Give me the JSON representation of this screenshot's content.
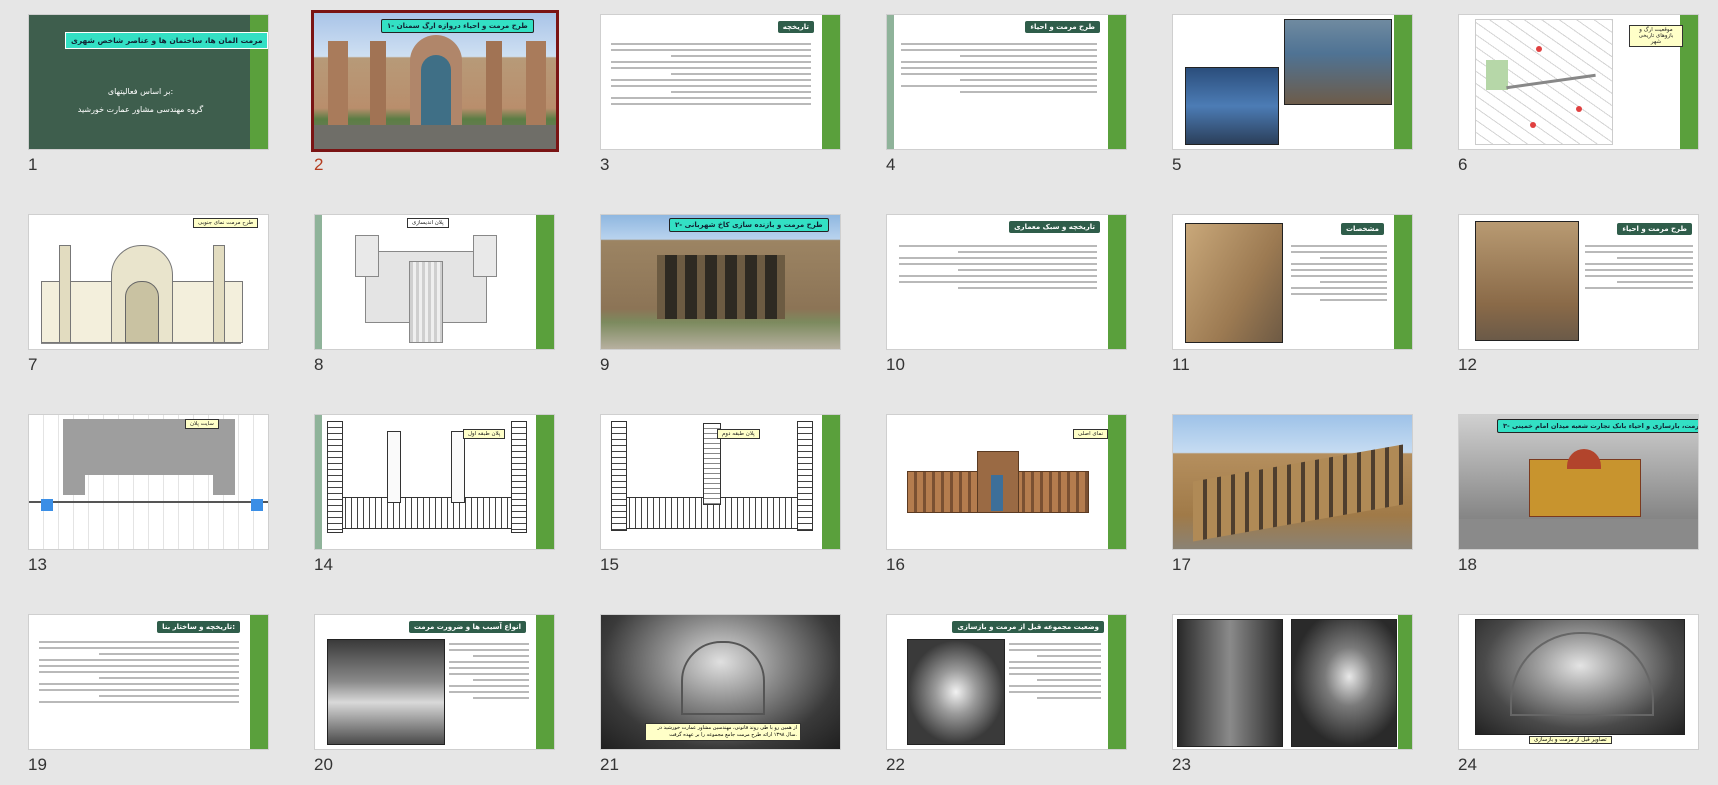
{
  "slide_numbers": [
    "1",
    "2",
    "3",
    "4",
    "5",
    "6",
    "7",
    "8",
    "9",
    "10",
    "11",
    "12",
    "13",
    "14",
    "15",
    "16",
    "17",
    "18",
    "19",
    "20",
    "21",
    "22",
    "23",
    "24"
  ],
  "selected_slide": "2",
  "s1": {
    "title": "مرمت المان ها، ساختمان ها و عناصر شاخص شهری",
    "line1": "بر اساس فعالیتهای:",
    "line2": "گروه مهندسی مشاور عمارت خورشید"
  },
  "s2": {
    "title": "۱- طرح مرمت و احیاء دروازه ارگ سمنان"
  },
  "s3": {
    "title": "تاریخچه"
  },
  "s4": {
    "title": "طرح مرمت و احیاء"
  },
  "s6": {
    "label": "موقعیت ارگ و بازوهای تاریخی شهر"
  },
  "s7": {
    "label": "طرح مرمت نمای جنوبی"
  },
  "s8": {
    "label": "پلان اندیسازی"
  },
  "s9": {
    "title": "۲- طرح مرمت و بازنده سازی کاخ شهربانی"
  },
  "s10": {
    "title": "تاریخچه و سبک معماری"
  },
  "s11": {
    "title": "مشخصات"
  },
  "s12": {
    "title": "طرح مرمت و احیاء"
  },
  "s13": {
    "label": "سایت پلان"
  },
  "s14": {
    "label": "پلان طبقه اول"
  },
  "s15": {
    "label": "پلان طبقه دوم"
  },
  "s16": {
    "label": "نمای اصلی"
  },
  "s18": {
    "title": "۳- مرمت، بازسازی و احیاء بانک تجارت شعبه میدان امام خمینی"
  },
  "s19": {
    "title": "تاریخچه و ساختار بنا:"
  },
  "s20": {
    "title": "انواع آسیب ها و ضرورت مرمت"
  },
  "s21": {
    "caption": "از همین رو با طی روند قانونی، مهندسین مشاور عمارت خورشید در سال ۱۳۹۸ ارائه طرح مرمت جامع مجموعه را بر عهده گرفت."
  },
  "s22": {
    "title": "وضعیت مجموعه قبل از مرمت و بازسازی"
  },
  "s24": {
    "caption": "تصاویر قبل از مرمت و بازسازی"
  },
  "colors": {
    "green_bar": "#5aa03c",
    "dark_green": "#3e5e4d",
    "aqua": "#33e0c4",
    "selection": "#7a1414"
  }
}
